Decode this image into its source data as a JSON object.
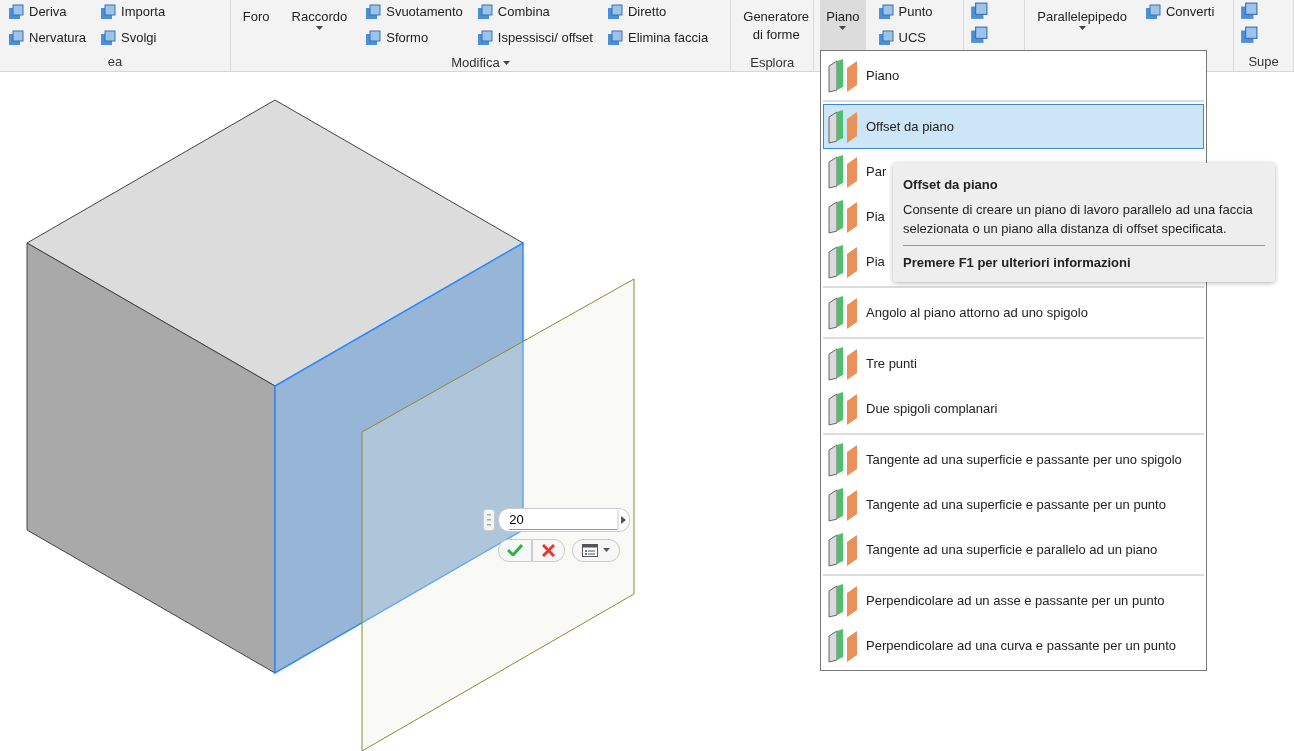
{
  "ribbon": {
    "groups": [
      {
        "label": "ea",
        "tools": [
          {
            "kind": "small",
            "label": "Deriva"
          },
          {
            "kind": "small",
            "label": "Nervatura"
          },
          {
            "kind": "small",
            "label": "Importa"
          },
          {
            "kind": "small",
            "label": "Svolgi"
          }
        ],
        "menu_caret": false
      },
      {
        "label": "Modifica",
        "tools": [
          {
            "kind": "large",
            "label": "Foro",
            "dropdown": false,
            "pressed": false
          },
          {
            "kind": "large",
            "label": "Raccordo",
            "dropdown": true,
            "pressed": false
          },
          {
            "kind": "small",
            "label": "Svuotamento"
          },
          {
            "kind": "small",
            "label": "Sformo"
          },
          {
            "kind": "small",
            "label": "Combina"
          },
          {
            "kind": "small",
            "label": "Ispessisci/ offset"
          },
          {
            "kind": "small",
            "label": "Diretto"
          },
          {
            "kind": "small",
            "label": "Elimina faccia"
          }
        ],
        "menu_caret": true
      },
      {
        "label": "Esplora",
        "tools": [
          {
            "kind": "large",
            "label": "Generatore di forme",
            "dropdown": false,
            "pressed": false
          }
        ],
        "menu_caret": false
      },
      {
        "tools": [
          {
            "kind": "large",
            "label": "Piano",
            "dropdown": true,
            "pressed": true
          },
          {
            "kind": "small",
            "label": "Punto"
          },
          {
            "kind": "small",
            "label": "UCS"
          }
        ]
      },
      {
        "tools": [
          {
            "kind": "icon"
          },
          {
            "kind": "icon"
          }
        ]
      },
      {
        "tools": [
          {
            "kind": "large",
            "label": "Parallelepipedo",
            "dropdown": true,
            "pressed": false
          },
          {
            "kind": "small",
            "label": "Converti"
          }
        ]
      },
      {
        "label": "Supe",
        "tools": [
          {
            "kind": "icon"
          },
          {
            "kind": "icon"
          }
        ],
        "menu_caret": false
      }
    ]
  },
  "plane_menu": {
    "items": [
      {
        "kind": "item",
        "label": "Piano",
        "selected": false
      },
      {
        "kind": "separator"
      },
      {
        "kind": "item",
        "label": "Offset da piano",
        "selected": true
      },
      {
        "kind": "item",
        "label": "Par",
        "selected": false
      },
      {
        "kind": "item",
        "label": "Pia",
        "selected": false
      },
      {
        "kind": "item",
        "label": "Pia",
        "selected": false
      },
      {
        "kind": "separator"
      },
      {
        "kind": "item",
        "label": "Angolo al piano attorno ad uno spigolo",
        "selected": false
      },
      {
        "kind": "separator"
      },
      {
        "kind": "item",
        "label": "Tre punti",
        "selected": false
      },
      {
        "kind": "item",
        "label": "Due spigoli complanari",
        "selected": false
      },
      {
        "kind": "separator"
      },
      {
        "kind": "item",
        "label": "Tangente ad una superficie e passante per uno spigolo",
        "selected": false
      },
      {
        "kind": "item",
        "label": "Tangente ad una superficie e passante per un punto",
        "selected": false
      },
      {
        "kind": "item",
        "label": "Tangente ad una superficie e parallelo ad un piano",
        "selected": false
      },
      {
        "kind": "separator"
      },
      {
        "kind": "item",
        "label": "Perpendicolare ad un asse e passante per un punto",
        "selected": false
      },
      {
        "kind": "item",
        "label": "Perpendicolare ad una curva e passante per un punto",
        "selected": false
      }
    ]
  },
  "tooltip": {
    "title": "Offset da piano",
    "description": "Consente di creare un piano di lavoro parallelo ad una faccia selezionata o un piano alla distanza di offset specificata.",
    "help": "Premere F1 per ulteriori informazioni"
  },
  "offset_input": {
    "value": "20"
  }
}
